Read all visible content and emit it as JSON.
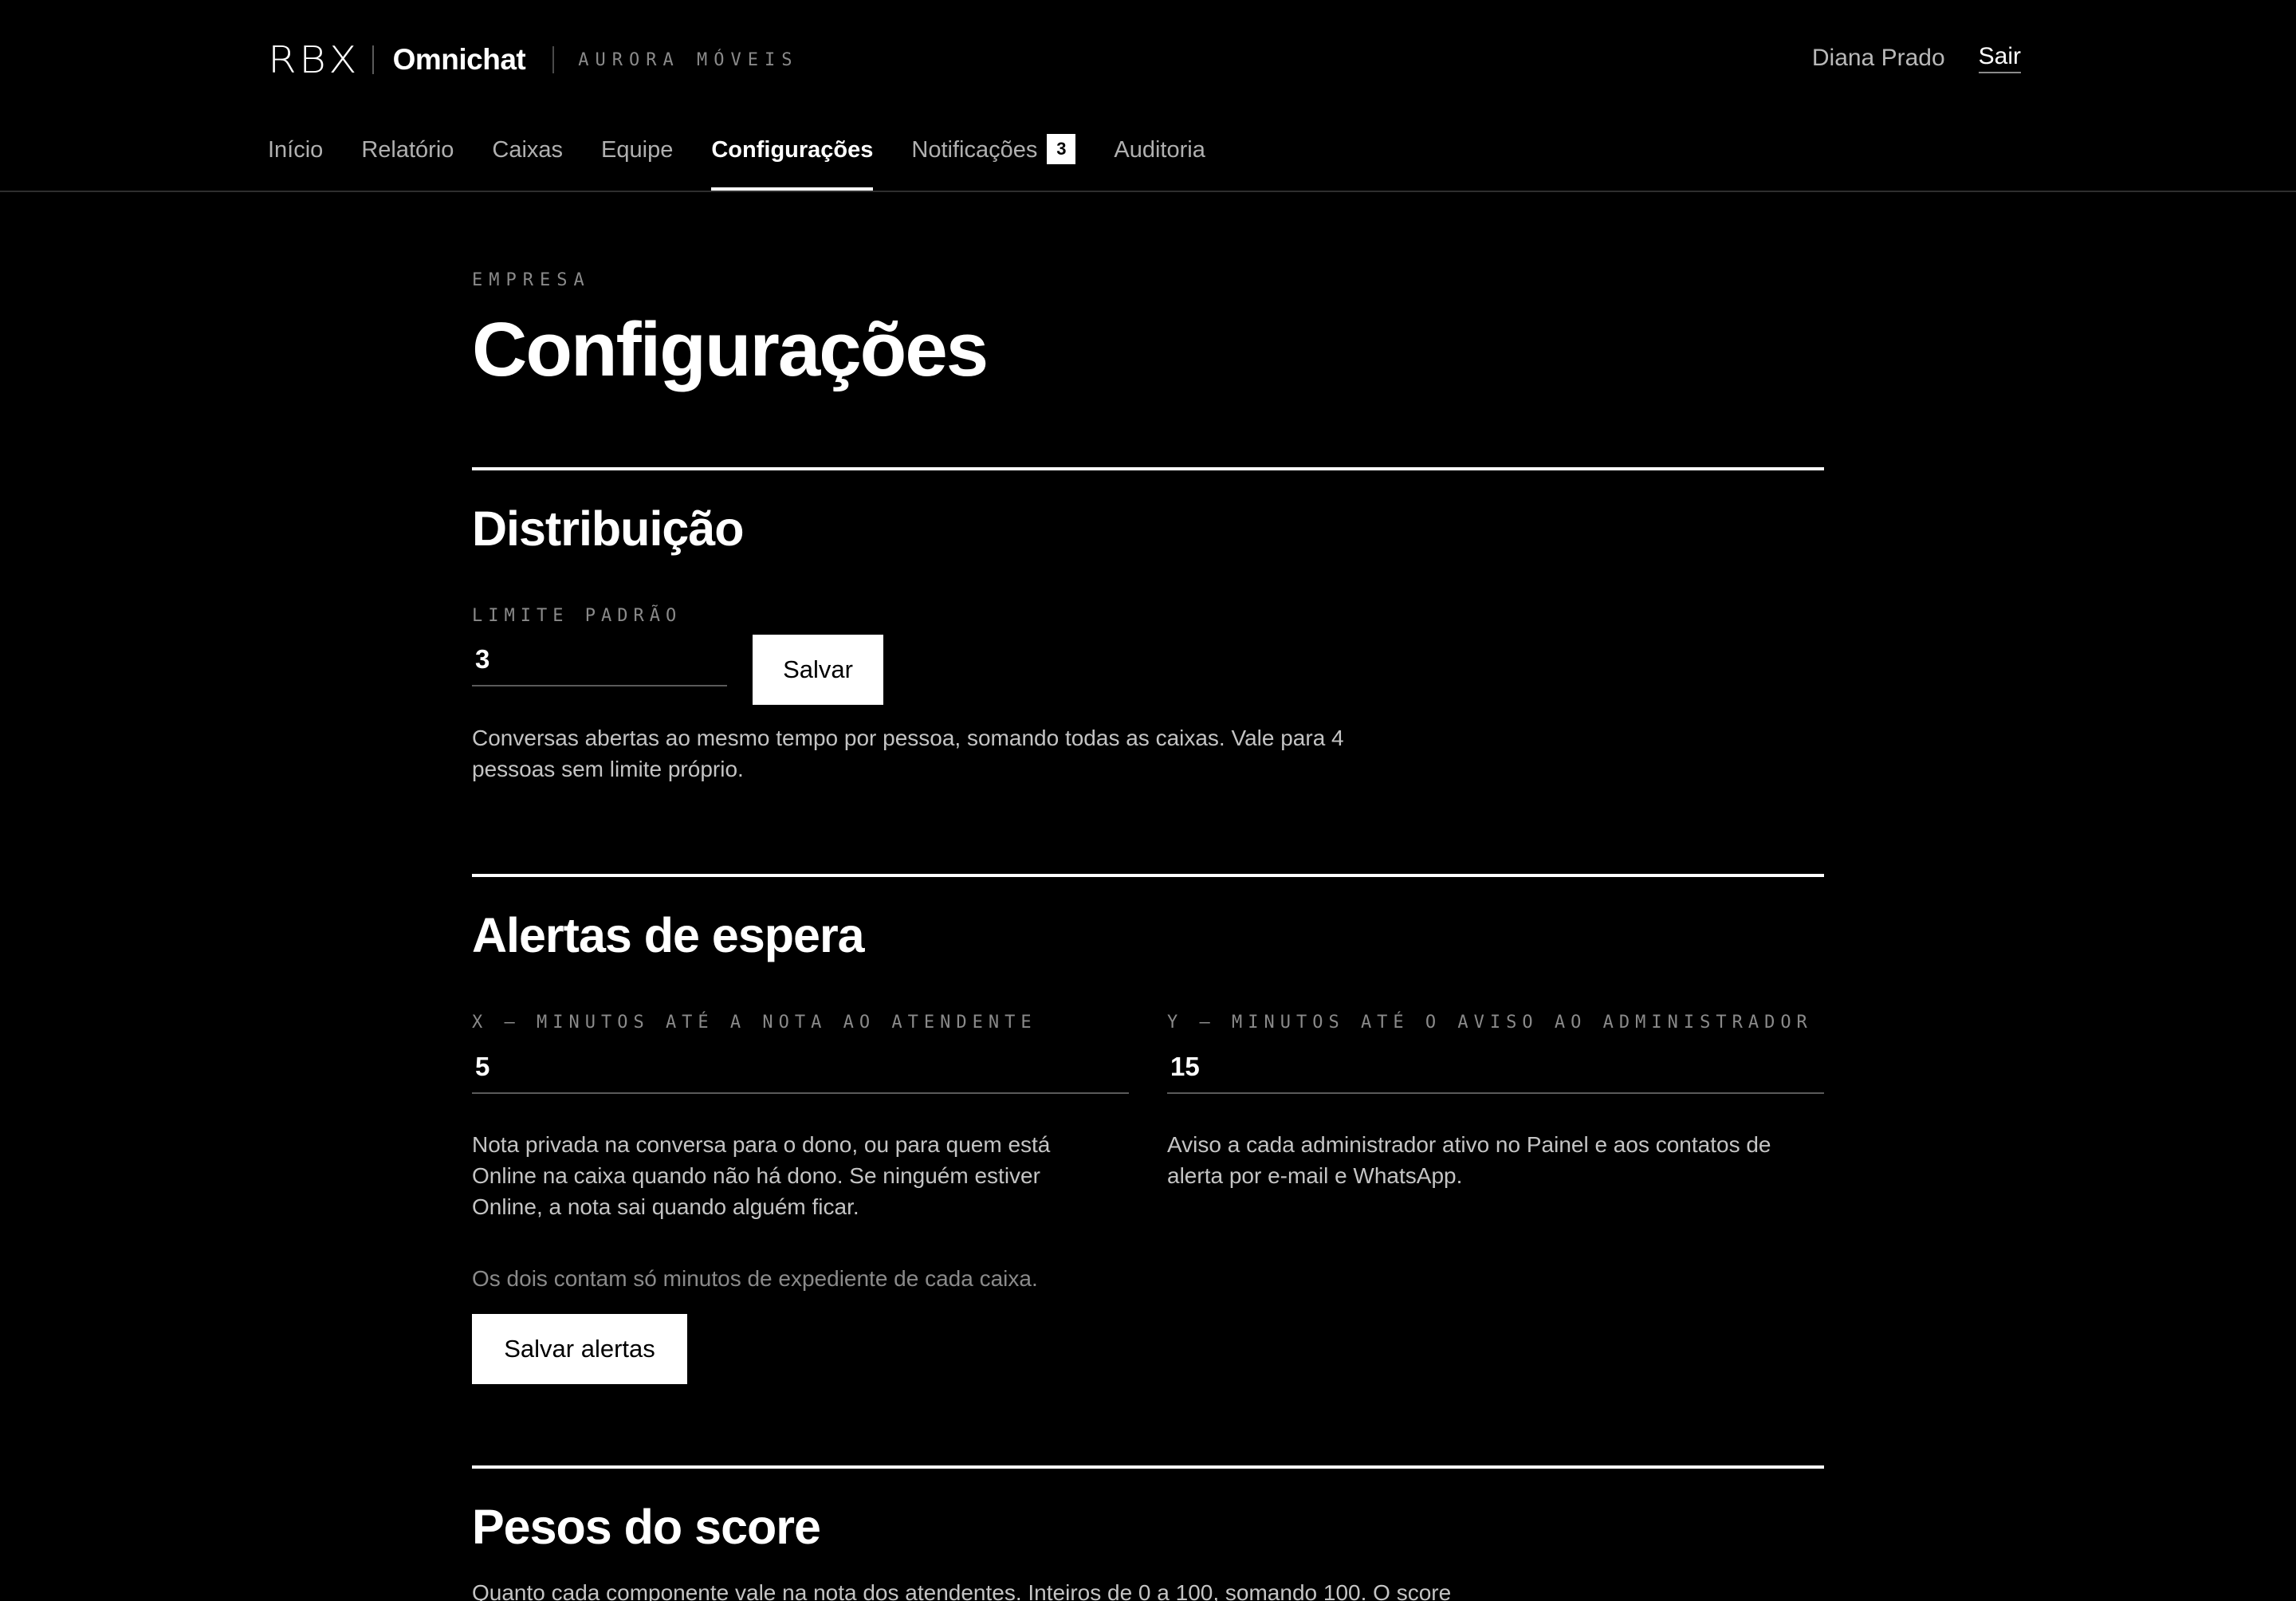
{
  "header": {
    "logo": "RBX",
    "product": "Omnichat",
    "company": "AURORA MÓVEIS",
    "user_name": "Diana Prado",
    "logout_label": "Sair"
  },
  "nav": {
    "items": [
      {
        "label": "Início"
      },
      {
        "label": "Relatório"
      },
      {
        "label": "Caixas"
      },
      {
        "label": "Equipe"
      },
      {
        "label": "Configurações",
        "active": true
      },
      {
        "label": "Notificações",
        "badge": "3"
      },
      {
        "label": "Auditoria"
      }
    ]
  },
  "page": {
    "eyebrow": "EMPRESA",
    "title": "Configurações"
  },
  "distribution": {
    "title": "Distribuição",
    "limit_label": "LIMITE PADRÃO",
    "limit_value": "3",
    "save_label": "Salvar",
    "help": "Conversas abertas ao mesmo tempo por pessoa, somando todas as caixas. Vale para 4 pessoas sem limite próprio."
  },
  "alerts": {
    "title": "Alertas de espera",
    "x_label": "X — MINUTOS ATÉ A NOTA AO ATENDENTE",
    "x_value": "5",
    "x_help": "Nota privada na conversa para o dono, ou para quem está Online na caixa quando não há dono. Se ninguém estiver Online, a nota sai quando alguém ficar.",
    "y_label": "Y — MINUTOS ATÉ O AVISO AO ADMINISTRADOR",
    "y_value": "15",
    "y_help": "Aviso a cada administrador ativo no Painel e aos contatos de alerta por e-mail e WhatsApp.",
    "note": "Os dois contam só minutos de expediente de cada caixa.",
    "save_label": "Salvar alertas"
  },
  "score": {
    "title": "Pesos do score",
    "help": "Quanto cada componente vale na nota dos atendentes. Inteiros de 0 a 100, somando 100. O score"
  }
}
